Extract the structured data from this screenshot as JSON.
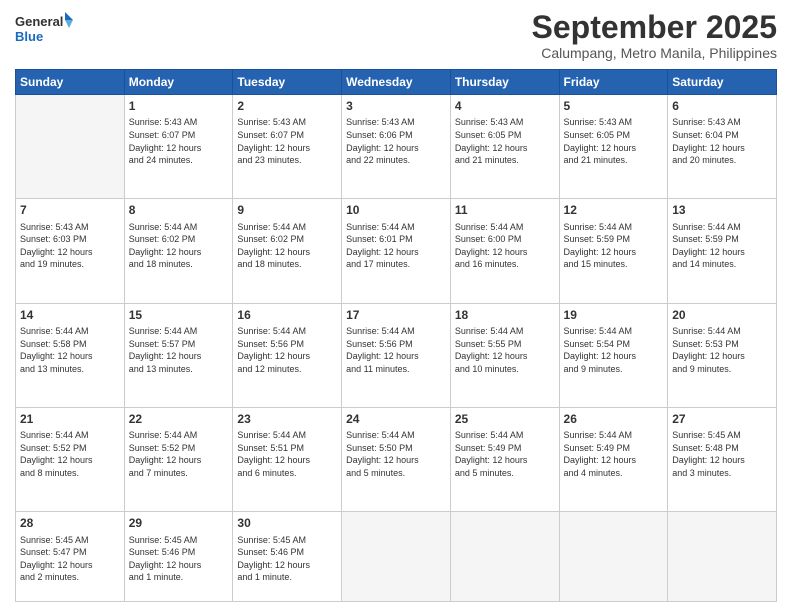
{
  "logo": {
    "line1": "General",
    "line2": "Blue"
  },
  "header": {
    "month": "September 2025",
    "location": "Calumpang, Metro Manila, Philippines"
  },
  "weekdays": [
    "Sunday",
    "Monday",
    "Tuesday",
    "Wednesday",
    "Thursday",
    "Friday",
    "Saturday"
  ],
  "weeks": [
    [
      {
        "day": "",
        "empty": true
      },
      {
        "day": "1",
        "sunrise": "5:43 AM",
        "sunset": "6:07 PM",
        "daylight": "12 hours and 24 minutes."
      },
      {
        "day": "2",
        "sunrise": "5:43 AM",
        "sunset": "6:07 PM",
        "daylight": "12 hours and 23 minutes."
      },
      {
        "day": "3",
        "sunrise": "5:43 AM",
        "sunset": "6:06 PM",
        "daylight": "12 hours and 22 minutes."
      },
      {
        "day": "4",
        "sunrise": "5:43 AM",
        "sunset": "6:05 PM",
        "daylight": "12 hours and 21 minutes."
      },
      {
        "day": "5",
        "sunrise": "5:43 AM",
        "sunset": "6:05 PM",
        "daylight": "12 hours and 21 minutes."
      },
      {
        "day": "6",
        "sunrise": "5:43 AM",
        "sunset": "6:04 PM",
        "daylight": "12 hours and 20 minutes."
      }
    ],
    [
      {
        "day": "7",
        "sunrise": "5:43 AM",
        "sunset": "6:03 PM",
        "daylight": "12 hours and 19 minutes."
      },
      {
        "day": "8",
        "sunrise": "5:44 AM",
        "sunset": "6:02 PM",
        "daylight": "12 hours and 18 minutes."
      },
      {
        "day": "9",
        "sunrise": "5:44 AM",
        "sunset": "6:02 PM",
        "daylight": "12 hours and 18 minutes."
      },
      {
        "day": "10",
        "sunrise": "5:44 AM",
        "sunset": "6:01 PM",
        "daylight": "12 hours and 17 minutes."
      },
      {
        "day": "11",
        "sunrise": "5:44 AM",
        "sunset": "6:00 PM",
        "daylight": "12 hours and 16 minutes."
      },
      {
        "day": "12",
        "sunrise": "5:44 AM",
        "sunset": "5:59 PM",
        "daylight": "12 hours and 15 minutes."
      },
      {
        "day": "13",
        "sunrise": "5:44 AM",
        "sunset": "5:59 PM",
        "daylight": "12 hours and 14 minutes."
      }
    ],
    [
      {
        "day": "14",
        "sunrise": "5:44 AM",
        "sunset": "5:58 PM",
        "daylight": "12 hours and 13 minutes."
      },
      {
        "day": "15",
        "sunrise": "5:44 AM",
        "sunset": "5:57 PM",
        "daylight": "12 hours and 13 minutes."
      },
      {
        "day": "16",
        "sunrise": "5:44 AM",
        "sunset": "5:56 PM",
        "daylight": "12 hours and 12 minutes."
      },
      {
        "day": "17",
        "sunrise": "5:44 AM",
        "sunset": "5:56 PM",
        "daylight": "12 hours and 11 minutes."
      },
      {
        "day": "18",
        "sunrise": "5:44 AM",
        "sunset": "5:55 PM",
        "daylight": "12 hours and 10 minutes."
      },
      {
        "day": "19",
        "sunrise": "5:44 AM",
        "sunset": "5:54 PM",
        "daylight": "12 hours and 9 minutes."
      },
      {
        "day": "20",
        "sunrise": "5:44 AM",
        "sunset": "5:53 PM",
        "daylight": "12 hours and 9 minutes."
      }
    ],
    [
      {
        "day": "21",
        "sunrise": "5:44 AM",
        "sunset": "5:52 PM",
        "daylight": "12 hours and 8 minutes."
      },
      {
        "day": "22",
        "sunrise": "5:44 AM",
        "sunset": "5:52 PM",
        "daylight": "12 hours and 7 minutes."
      },
      {
        "day": "23",
        "sunrise": "5:44 AM",
        "sunset": "5:51 PM",
        "daylight": "12 hours and 6 minutes."
      },
      {
        "day": "24",
        "sunrise": "5:44 AM",
        "sunset": "5:50 PM",
        "daylight": "12 hours and 5 minutes."
      },
      {
        "day": "25",
        "sunrise": "5:44 AM",
        "sunset": "5:49 PM",
        "daylight": "12 hours and 5 minutes."
      },
      {
        "day": "26",
        "sunrise": "5:44 AM",
        "sunset": "5:49 PM",
        "daylight": "12 hours and 4 minutes."
      },
      {
        "day": "27",
        "sunrise": "5:45 AM",
        "sunset": "5:48 PM",
        "daylight": "12 hours and 3 minutes."
      }
    ],
    [
      {
        "day": "28",
        "sunrise": "5:45 AM",
        "sunset": "5:47 PM",
        "daylight": "12 hours and 2 minutes."
      },
      {
        "day": "29",
        "sunrise": "5:45 AM",
        "sunset": "5:46 PM",
        "daylight": "12 hours and 1 minute."
      },
      {
        "day": "30",
        "sunrise": "5:45 AM",
        "sunset": "5:46 PM",
        "daylight": "12 hours and 1 minute."
      },
      {
        "day": "",
        "empty": true
      },
      {
        "day": "",
        "empty": true
      },
      {
        "day": "",
        "empty": true
      },
      {
        "day": "",
        "empty": true
      }
    ]
  ]
}
